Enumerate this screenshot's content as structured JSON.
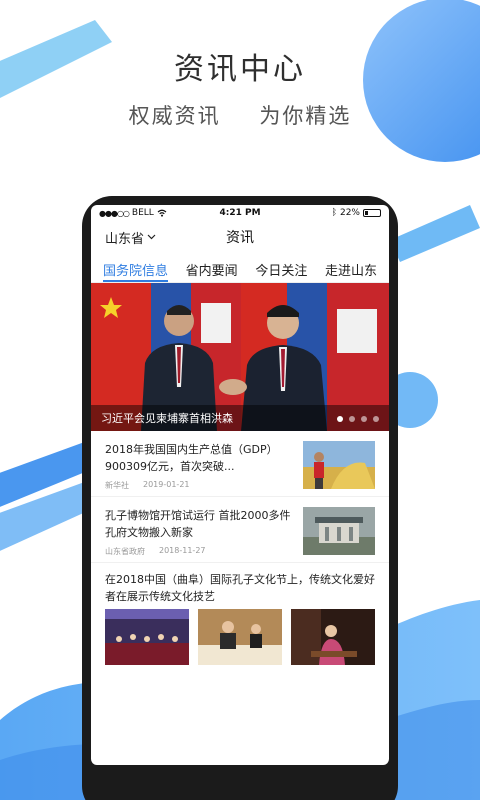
{
  "promo": {
    "title": "资讯中心",
    "subtitle_left": "权威资讯",
    "subtitle_right": "为你精选"
  },
  "status_bar": {
    "carrier": "BELL",
    "time": "4:21 PM",
    "battery": "22%"
  },
  "nav": {
    "province": "山东省",
    "title": "资讯"
  },
  "tabs": [
    {
      "label": "国务院信息",
      "active": true
    },
    {
      "label": "省内要闻",
      "active": false
    },
    {
      "label": "今日关注",
      "active": false
    },
    {
      "label": "走进山东",
      "active": false
    }
  ],
  "banner": {
    "caption": "习近平会见柬埔寨首相洪森",
    "page_count": 4,
    "active_index": 0
  },
  "news": [
    {
      "title": "2018年我国国内生产总值（GDP）900309亿元，首次突破...",
      "source": "新华社",
      "date": "2019-01-21",
      "thumb_icon": "farmer-harvest-icon"
    },
    {
      "title": "孔子博物馆开馆试运行 首批2000多件孔府文物搬入新家",
      "source": "山东省政府",
      "date": "2018-11-27",
      "thumb_icon": "museum-building-icon"
    }
  ],
  "multi_news": {
    "title": "在2018中国（曲阜）国际孔子文化节上，传统文化爱好者在展示传统文化技艺",
    "thumb_icons": [
      "orchestra-performance-icon",
      "calligraphy-icon",
      "guqin-player-icon"
    ]
  },
  "colors": {
    "accent": "#2f7de1",
    "blob_blue": "#4d9cf0"
  }
}
